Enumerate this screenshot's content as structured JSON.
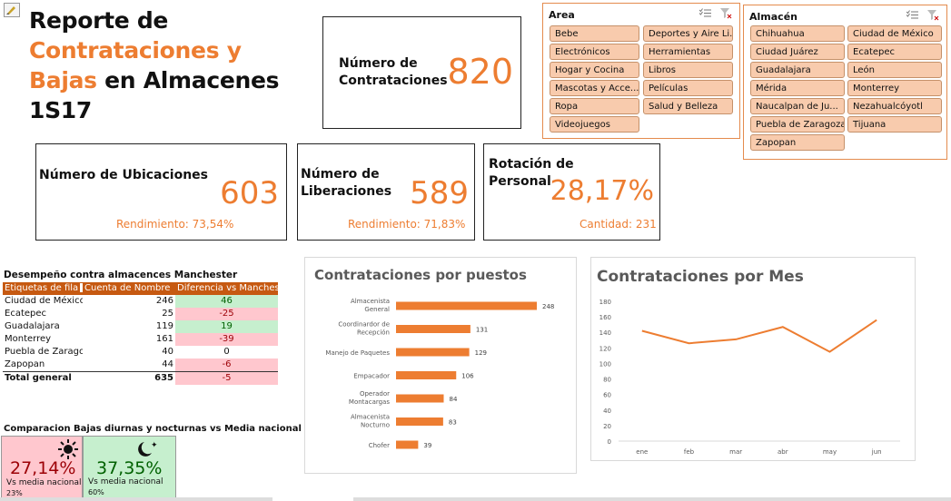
{
  "title": {
    "line1": "Reporte de",
    "line2": "Contrataciones y",
    "line3a": "Bajas",
    "line3b": " en Almacenes",
    "line4": "1S17"
  },
  "kpis": {
    "contrataciones": {
      "label": "Número de Contrataciones",
      "value": "820"
    },
    "ubicaciones": {
      "label": "Número de Ubicaciones",
      "value": "603",
      "sub": "Rendimiento: 73,54%"
    },
    "liberaciones": {
      "label": "Número de Liberaciones",
      "value": "589",
      "sub": "Rendimiento: 71,83%"
    },
    "rotacion": {
      "label": "Rotación de Personal",
      "value": "28,17%",
      "sub": "Cantidad: 231"
    }
  },
  "slicer_area": {
    "title": "Area",
    "items": [
      "Bebe",
      "Deportes y Aire Li...",
      "Electrónicos",
      "Herramientas",
      "Hogar y Cocina",
      "Libros",
      "Mascotas y Acce...",
      "Películas",
      "Ropa",
      "Salud y Belleza",
      "Videojuegos"
    ]
  },
  "slicer_almacen": {
    "title": "Almacén",
    "items": [
      "Chihuahua",
      "Ciudad de México",
      "Ciudad Juárez",
      "Ecatepec",
      "Guadalajara",
      "León",
      "Mérida",
      "Monterrey",
      "Naucalpan de Ju...",
      "Nezahualcóyotl",
      "Puebla de Zaragoza",
      "Tijuana",
      "Zapopan"
    ]
  },
  "pivot": {
    "title": "Desempeño contra almacences Manchester",
    "headers": [
      "Etiquetas de fila",
      "Cuenta de Nombre",
      "Diferencia vs Manchester"
    ],
    "rows": [
      {
        "name": "Ciudad de México",
        "count": "246",
        "diff": "46",
        "status": "pos"
      },
      {
        "name": "Ecatepec",
        "count": "25",
        "diff": "-25",
        "status": "neg"
      },
      {
        "name": "Guadalajara",
        "count": "119",
        "diff": "19",
        "status": "pos"
      },
      {
        "name": "Monterrey",
        "count": "161",
        "diff": "-39",
        "status": "neg"
      },
      {
        "name": "Puebla de Zaragoz",
        "count": "40",
        "diff": "0",
        "status": "neutral"
      },
      {
        "name": "Zapopan",
        "count": "44",
        "diff": "-6",
        "status": "neg"
      }
    ],
    "total": {
      "name": "Total general",
      "count": "635",
      "diff": "-5"
    }
  },
  "comparison": {
    "title": "Comparacion Bajas diurnas y nocturnas vs Media nacional",
    "day": {
      "value": "27,14%",
      "label": "Vs media nacional",
      "ref": "23%"
    },
    "night": {
      "value": "37,35%",
      "label": "Vs media nacional",
      "ref": "60%"
    }
  },
  "colors": {
    "accent": "#ed7d31",
    "pos_bg": "#c6efce",
    "pos_fg": "#006100",
    "neg_bg": "#ffc7ce",
    "neg_fg": "#9c0006"
  },
  "chart_data": [
    {
      "type": "bar",
      "orientation": "horizontal",
      "title": "Contrataciones por puestos",
      "categories": [
        "Almacenista General",
        "Coordinardor de Recepción",
        "Manejo de Paquetes",
        "Empacador",
        "Operador Montacargas",
        "Almacenista Nocturno",
        "Chofer"
      ],
      "values": [
        248,
        131,
        129,
        106,
        84,
        83,
        39
      ],
      "data_labels": true,
      "color": "#ed7d31"
    },
    {
      "type": "line",
      "title": "Contrataciones por Mes",
      "categories": [
        "ene",
        "feb",
        "mar",
        "abr",
        "may",
        "jun"
      ],
      "values": [
        142,
        126,
        131,
        147,
        115,
        156
      ],
      "ylim": [
        0,
        180
      ],
      "yticks": [
        0,
        20,
        40,
        60,
        80,
        100,
        120,
        140,
        160,
        180
      ],
      "grid": false,
      "color": "#ed7d31"
    }
  ]
}
